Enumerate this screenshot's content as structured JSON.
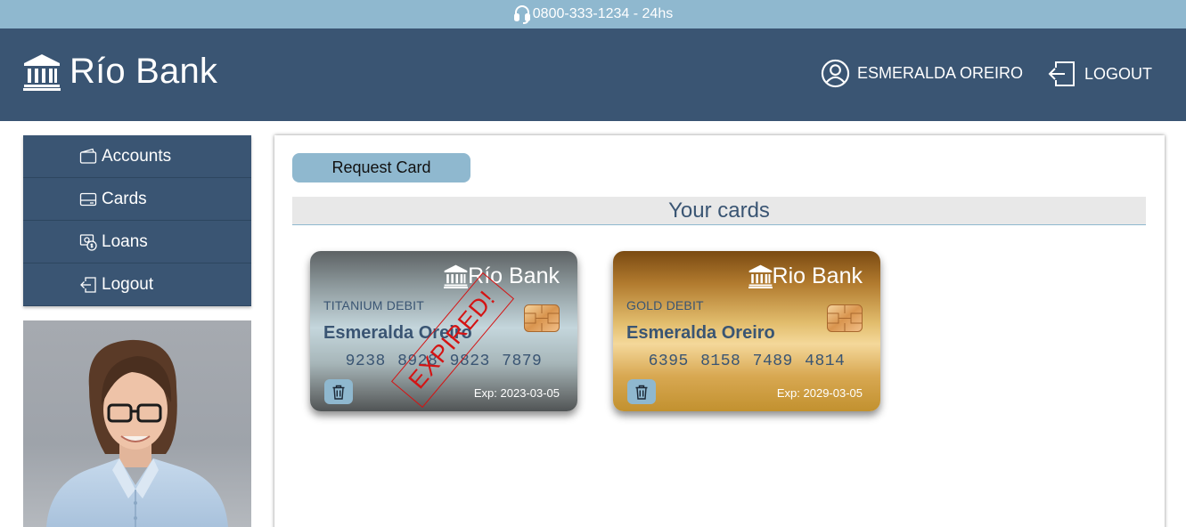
{
  "topbar": {
    "phone_text": "0800-333-1234 - 24hs",
    "icon": "headset-icon"
  },
  "header": {
    "brand_name": "Río Bank",
    "brand_icon": "bank-icon",
    "user_name": "ESMERALDA OREIRO",
    "user_icon": "user-circle-icon",
    "logout_label": "LOGOUT",
    "logout_icon": "logout-icon"
  },
  "sidebar": {
    "items": [
      {
        "label": "Accounts",
        "icon": "wallet-icon"
      },
      {
        "label": "Cards",
        "icon": "credit-card-icon"
      },
      {
        "label": "Loans",
        "icon": "cash-icon"
      },
      {
        "label": "Logout",
        "icon": "logout-icon"
      }
    ]
  },
  "main": {
    "request_button_label": "Request Card",
    "section_title": "Your cards",
    "cards": [
      {
        "brand": "Río Bank",
        "type": "TITANIUM DEBIT",
        "holder": "Esmeralda Oreiro",
        "number": "9238 8928 9823 7879",
        "expiry": "Exp: 2023-03-05",
        "stamp": "EXPIRED!",
        "style": "titanium"
      },
      {
        "brand": "Rio Bank",
        "type": "GOLD DEBIT",
        "holder": "Esmeralda Oreiro",
        "number": "6395 8158 7489 4814",
        "expiry": "Exp: 2029-03-05",
        "style": "gold"
      }
    ]
  },
  "colors": {
    "topbar": "#8fb8cf",
    "header": "#3a5573",
    "accent": "#8fb8cf",
    "expired_stamp": "#d41414"
  }
}
